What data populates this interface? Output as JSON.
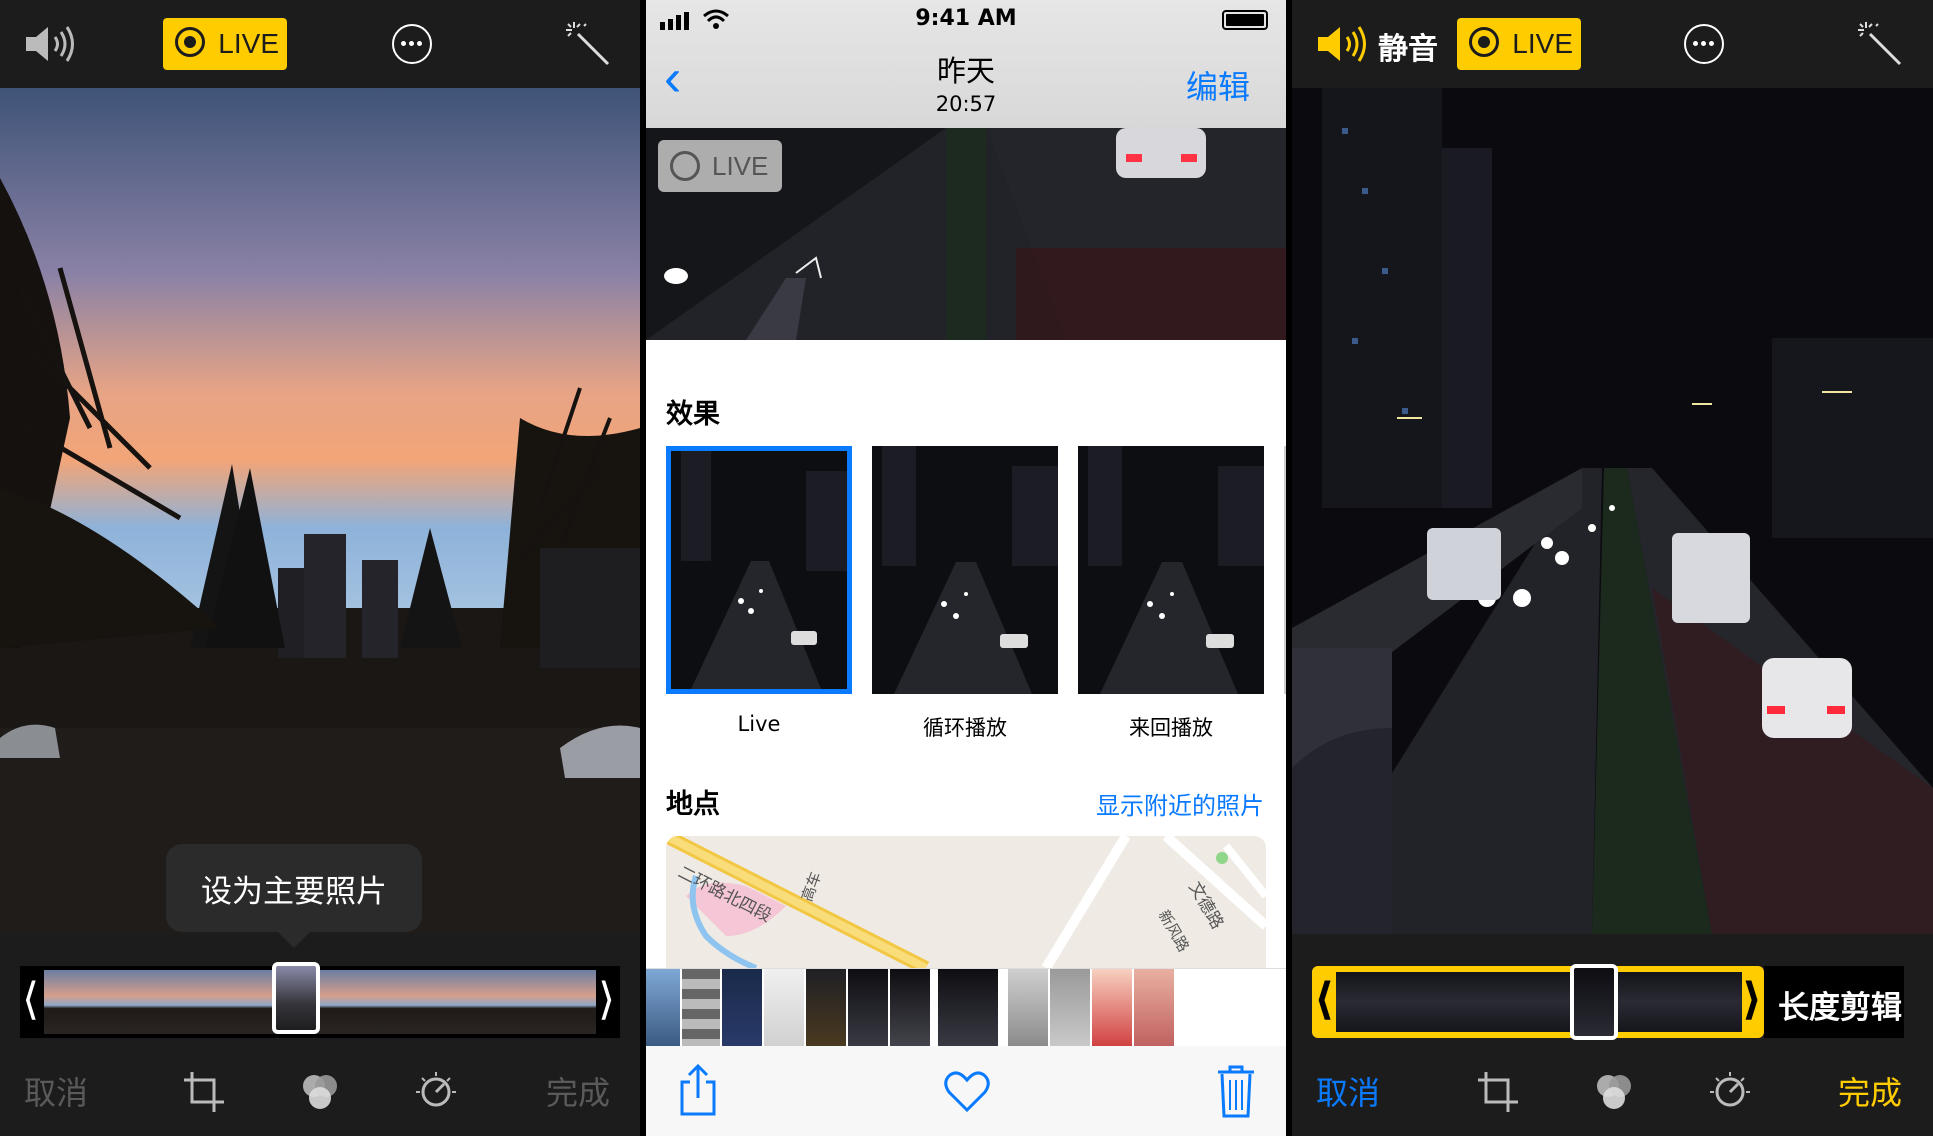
{
  "left": {
    "live_label": "LIVE",
    "key_photo_tooltip": "设为主要照片",
    "cancel": "取消",
    "done": "完成",
    "icons": [
      "speaker-icon",
      "live-icon",
      "more-icon",
      "magic-wand-icon",
      "crop-icon",
      "filters-icon",
      "adjust-icon"
    ]
  },
  "middle": {
    "status": {
      "time": "9:41 AM"
    },
    "nav": {
      "title": "昨天",
      "subtitle": "20:57",
      "edit": "编辑"
    },
    "live_badge": "LIVE",
    "effects": {
      "title": "效果",
      "items": [
        {
          "label": "Live",
          "selected": true
        },
        {
          "label": "循环播放",
          "selected": false
        },
        {
          "label": "来回播放",
          "selected": false
        }
      ]
    },
    "places": {
      "title": "地点",
      "show_nearby": "显示附近的照片",
      "map_labels": [
        "二环路北四段",
        "高车",
        "文德路",
        "新风路"
      ]
    },
    "accent": "#0a7aff"
  },
  "right": {
    "mute_label": "静音",
    "live_label": "LIVE",
    "trim_label": "长度剪辑",
    "cancel": "取消",
    "done": "完成",
    "accent_yellow": "#ffcc00",
    "accent_blue": "#0a7aff"
  }
}
